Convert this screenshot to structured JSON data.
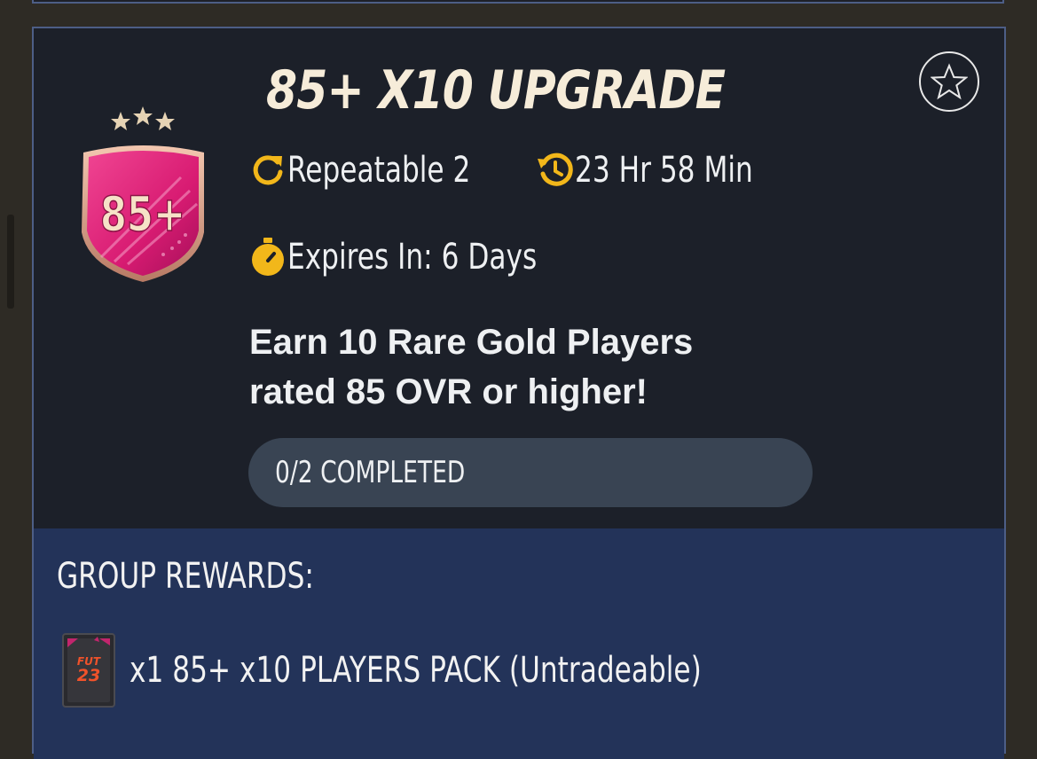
{
  "sbc": {
    "title": "85+ X10 UPGRADE",
    "badge_label": "85+",
    "repeatable": "Repeatable 2",
    "refresh_timer": "23 Hr 58 Min",
    "expires": "Expires In: 6 Days",
    "description_line1": "Earn 10 Rare Gold Players",
    "description_line2": "rated 85 OVR or higher!",
    "progress_label": "0/2 COMPLETED",
    "progress_fraction": 0,
    "favorite_icon": "star-outline-icon"
  },
  "rewards": {
    "title": "GROUP REWARDS:",
    "items": [
      {
        "pack_logo_line1": "FUT",
        "pack_logo_line2": "23",
        "label": "x1 85+ x10 PLAYERS PACK (Untradeable)"
      }
    ]
  },
  "colors": {
    "background": "#2e2b25",
    "card": "#1c2029",
    "card_border": "#4d5e86",
    "title": "#f6ecd9",
    "icon_accent": "#f2b71a",
    "progress_track": "#394453",
    "rewards_panel": "#233359",
    "badge_pink": "#e6227a"
  }
}
